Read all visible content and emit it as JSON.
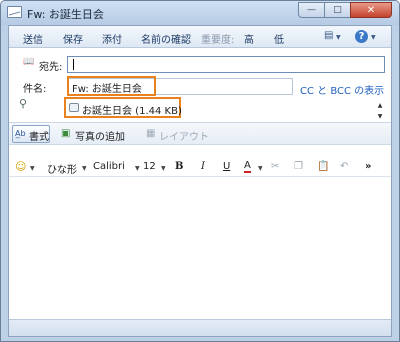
{
  "window": {
    "title": "Fw: お誕生日会",
    "min_glyph": "—",
    "max_glyph": "□",
    "close_glyph": "✕"
  },
  "toolbar": {
    "send": "送信",
    "save": "保存",
    "attach": "添付",
    "check_names": "名前の確認",
    "importance_label": "重要度:",
    "high": "高",
    "low": "低",
    "menu_glyph": "▤",
    "help_glyph": "?"
  },
  "header": {
    "to_label": "宛先:",
    "to_value": "",
    "subject_label": "件名:",
    "subject_value": "Fw: お誕生日会",
    "cc_bcc_link": "CC と BCC の表示",
    "attachment_name": "お誕生日会 (1.44 KB)"
  },
  "format_bar": {
    "format": "書式",
    "add_photos": "写真の追加",
    "layout": "レイアウト"
  },
  "font_bar": {
    "emoticon": "☺",
    "stationery": "ひな形",
    "font_name": "Calibri",
    "font_size": "12",
    "bold": "B",
    "italic": "I",
    "underline": "U",
    "font_color": "A",
    "more": "»"
  },
  "colors": {
    "highlight": "#e8821e",
    "link": "#1f5fbf",
    "toolbar_text": "#1e3a64"
  }
}
